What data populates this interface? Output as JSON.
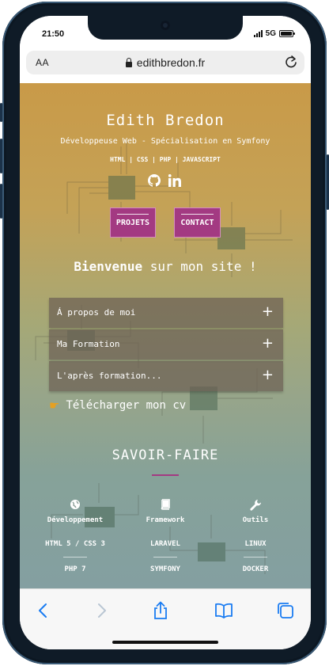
{
  "status_bar": {
    "time": "21:50",
    "network": "5G"
  },
  "browser": {
    "text_size_label": "AA",
    "url": "edithbredon.fr"
  },
  "site": {
    "name": "Edith Bredon",
    "subtitle": "Développeuse Web - Spécialisation en Symfony",
    "skills_line": "HTML | CSS | PHP | JAVASCRIPT",
    "buttons": {
      "projects": "PROJETS",
      "contact": "CONTACT"
    },
    "welcome_bold": "Bienvenue",
    "welcome_rest": " sur mon site !",
    "accordion": [
      {
        "label": "Á propos de moi"
      },
      {
        "label": "Ma Formation"
      },
      {
        "label": "L'après formation..."
      }
    ],
    "download_label": "Télécharger mon cv",
    "savoir_title": "SAVOIR-FAIRE",
    "columns": [
      {
        "title": "Développement",
        "items": [
          "HTML 5 / CSS 3",
          "PHP 7"
        ]
      },
      {
        "title": "Framework",
        "items": [
          "LARAVEL",
          "SYMFONY"
        ]
      },
      {
        "title": "Outils",
        "items": [
          "LINUX",
          "DOCKER"
        ]
      }
    ]
  },
  "colors": {
    "accent": "#a33a82",
    "accordion_bg": "#6c6054",
    "hand_icon": "#e5a022",
    "toolbar_icon": "#1a7cf2"
  }
}
